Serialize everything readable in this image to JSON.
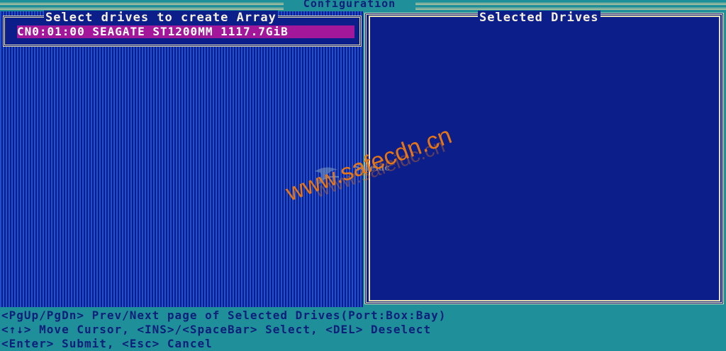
{
  "header": {
    "title": "Configuration"
  },
  "left_panel": {
    "label": "Select drives to create Array",
    "drives": [
      {
        "text": "CN0:01:00  SEAGATE ST1200MM 1117.7GiB",
        "selected": true
      }
    ]
  },
  "right_panel": {
    "label": "Selected Drives"
  },
  "footer": {
    "line1": "<PgUp/PgDn> Prev/Next page of Selected Drives(Port:Box:Bay)",
    "line2": "<↑↓> Move Cursor, <INS>/<SpaceBar> Select, <DEL> Deselect",
    "line3": "<Enter> Submit, <Esc> Cancel"
  },
  "watermark": {
    "brand": "Safeidc",
    "url": "www.safecdn.cn",
    "url_ghost": "www.safeidc.cn"
  },
  "colors": {
    "background": "#1f8f9a",
    "panel": "#0c1e8a",
    "highlight": "#a3189b",
    "border": "#e7dfb0",
    "watermark": "#f07a10"
  }
}
